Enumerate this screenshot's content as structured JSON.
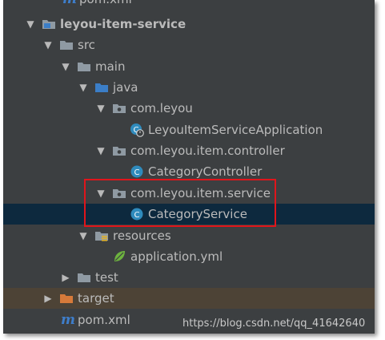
{
  "tree": {
    "pom_top": "pom.xml",
    "module": "leyou-item-service",
    "src": "src",
    "main": "main",
    "java": "java",
    "pkg_root": "com.leyou",
    "app_class": "LeyouItemServiceApplication",
    "pkg_controller": "com.leyou.item.controller",
    "controller_class": "CategoryController",
    "pkg_service": "com.leyou.item.service",
    "service_class": "CategoryService",
    "resources": "resources",
    "app_yml": "application.yml",
    "test": "test",
    "target": "target",
    "pom": "pom.xml"
  },
  "class_badge": "C",
  "watermark": "https://blog.csdn.net/qq_41642640",
  "colors": {
    "background": "#3c3f41",
    "selected_row": "#0d293e",
    "excluded_row": "#4d4336",
    "annotation_box": "#e0151b",
    "folder_gray": "#8f9aa3",
    "folder_blue": "#3b7ec7",
    "folder_orange": "#d77a3a",
    "class_badge": "#2f8bbd",
    "maven_blue": "#3e7ecb"
  }
}
